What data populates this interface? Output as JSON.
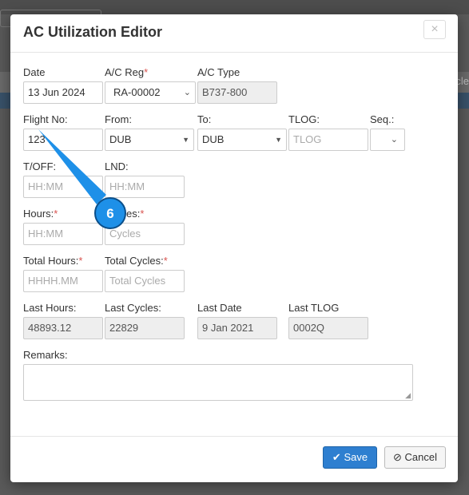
{
  "background": {
    "partial_label": "icle"
  },
  "modal": {
    "title": "AC Utilization Editor",
    "close_glyph": "×"
  },
  "fields": {
    "date": {
      "label": "Date",
      "value": "13 Jun 2024"
    },
    "ac_reg": {
      "label": "A/C Reg",
      "required_mark": "*",
      "value": "RA-00002"
    },
    "ac_type": {
      "label": "A/C Type",
      "value": "B737-800"
    },
    "flight_no": {
      "label": "Flight No:",
      "value": "123"
    },
    "from": {
      "label": "From:",
      "value": "DUB"
    },
    "to": {
      "label": "To:",
      "value": "DUB"
    },
    "tlog": {
      "label": "TLOG:",
      "placeholder": "TLOG"
    },
    "seq": {
      "label": "Seq.:",
      "value": ""
    },
    "toff": {
      "label": "T/OFF:",
      "placeholder": "HH:MM"
    },
    "lnd": {
      "label": "LND:",
      "placeholder": "HH:MM"
    },
    "hours": {
      "label": "Hours:",
      "required_mark": "*",
      "placeholder": "HH:MM"
    },
    "cycles": {
      "label": "es:",
      "required_mark": "*",
      "placeholder": "Cycles"
    },
    "total_hours": {
      "label": "Total Hours:",
      "required_mark": "*",
      "placeholder": "HHHH.MM"
    },
    "total_cycles": {
      "label": "Total Cycles:",
      "required_mark": "*",
      "placeholder": "Total Cycles"
    },
    "last_hours": {
      "label": "Last Hours:",
      "value": "48893.12"
    },
    "last_cycles": {
      "label": "Last Cycles:",
      "value": "22829"
    },
    "last_date": {
      "label": "Last Date",
      "value": "9 Jan 2021"
    },
    "last_tlog": {
      "label": "Last TLOG",
      "value": "0002Q"
    },
    "remarks": {
      "label": "Remarks:",
      "value": ""
    }
  },
  "footer": {
    "save_label": "Save",
    "save_icon": "check-icon",
    "cancel_label": "Cancel",
    "cancel_icon": "ban-icon"
  },
  "callout": {
    "step_number": "6",
    "color": "#1e90e8"
  },
  "colors": {
    "primary": "#2e7fd0",
    "required": "#d9534f",
    "readonly_bg": "#eeeeee"
  }
}
